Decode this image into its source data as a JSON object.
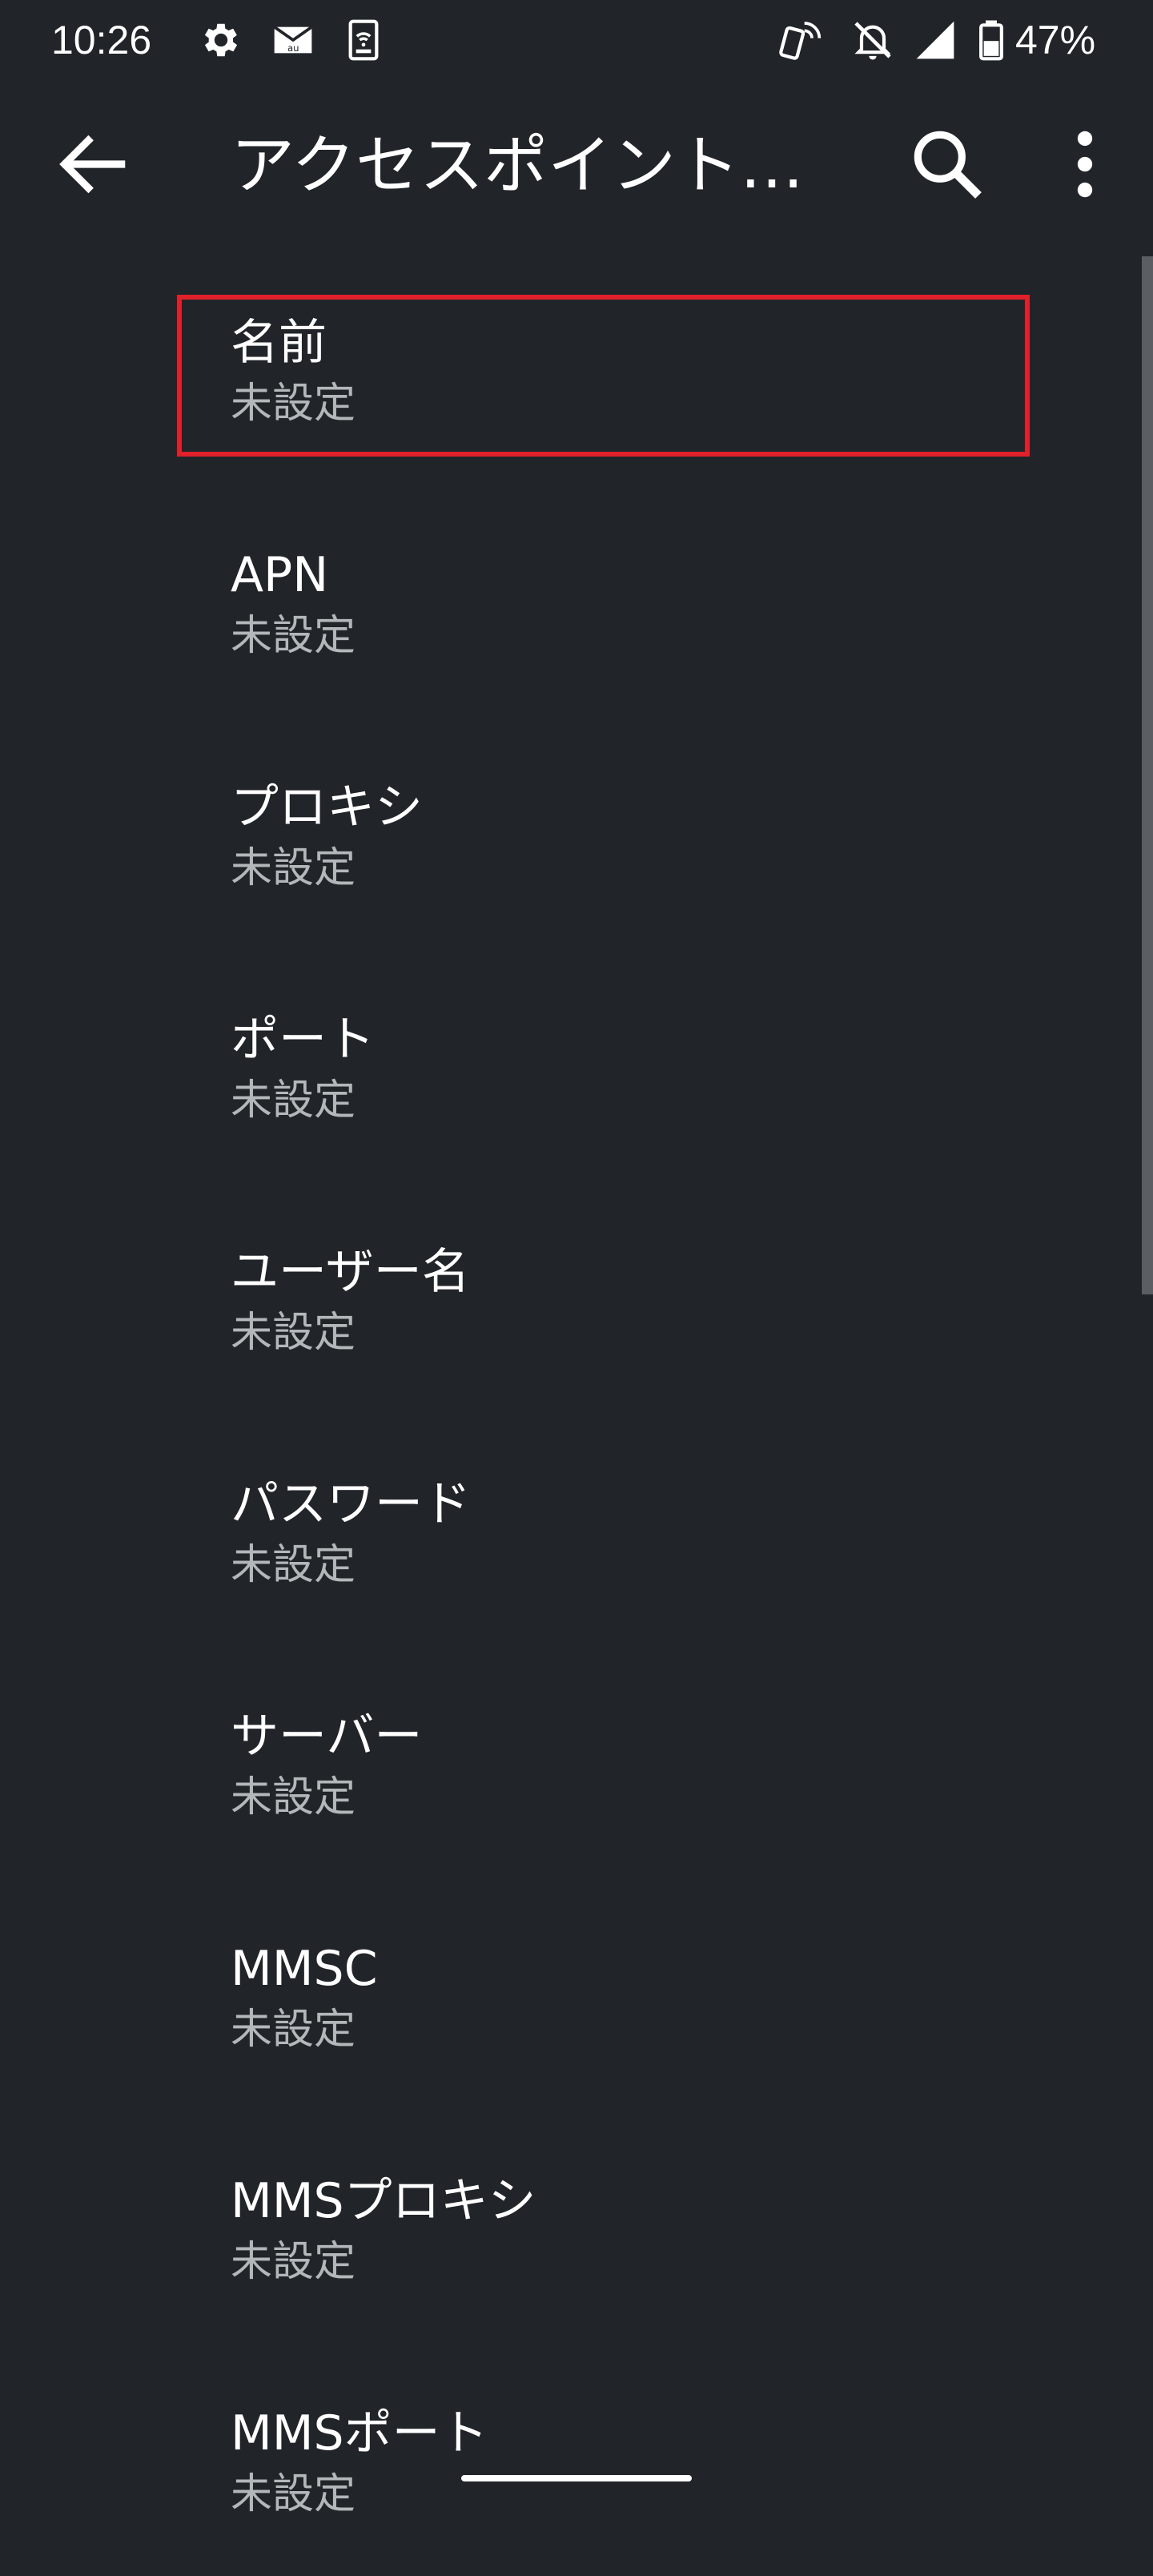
{
  "status_bar": {
    "time": "10:26",
    "battery_percent": "47%",
    "icons": [
      "gear-icon",
      "mail-icon",
      "sim-wifi-icon",
      "nfc-phone-icon",
      "bell-off-icon",
      "signal-icon",
      "battery-icon"
    ]
  },
  "app_bar": {
    "title": "アクセスポイント…",
    "back_icon": "arrow-left-icon",
    "search_icon": "search-icon",
    "more_icon": "more-vert-icon"
  },
  "items": [
    {
      "title": "名前",
      "value": "未設定"
    },
    {
      "title": "APN",
      "value": "未設定"
    },
    {
      "title": "プロキシ",
      "value": "未設定"
    },
    {
      "title": "ポート",
      "value": "未設定"
    },
    {
      "title": "ユーザー名",
      "value": "未設定"
    },
    {
      "title": "パスワード",
      "value": "未設定"
    },
    {
      "title": "サーバー",
      "value": "未設定"
    },
    {
      "title": "MMSC",
      "value": "未設定"
    },
    {
      "title": "MMSプロキシ",
      "value": "未設定"
    },
    {
      "title": "MMSポート",
      "value": "未設定"
    }
  ],
  "colors": {
    "background": "#212529",
    "highlight": "#e0202a",
    "secondary_text": "#b4b7ba"
  }
}
